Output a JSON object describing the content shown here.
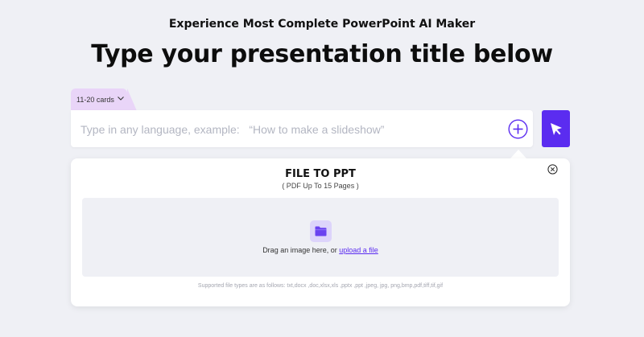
{
  "header": {
    "tagline": "Experience Most Complete PowerPoint AI Maker",
    "headline": "Type your presentation title below"
  },
  "cards_selector": {
    "value": "11-20 cards",
    "icon": "chevron-down-icon"
  },
  "search": {
    "placeholder": "Type in any language, example:   “How to make a slideshow”",
    "value": "",
    "add_icon": "plus-circle-icon"
  },
  "send_button": {
    "icon": "cursor-pointer-icon",
    "color": "#5b2cf0"
  },
  "file_panel": {
    "title": "FILE TO PPT",
    "subtitle": "( PDF Up To 15 Pages )",
    "close_icon": "close-circle-icon",
    "dropzone": {
      "icon": "folder-icon",
      "text_prefix": "Drag an image here, or ",
      "upload_link": "upload a file"
    },
    "supported_types": "Supported file types are as follows: txt,docx ,doc,xlsx,xls ,pptx ,ppt ,jpeg, jpg, png,bmp,pdf,tiff,tif,gif"
  },
  "colors": {
    "background": "#eff0f5",
    "accent": "#5b2cf0",
    "tab": "#e9d5f8",
    "folder_bg": "#ddd4fb"
  }
}
